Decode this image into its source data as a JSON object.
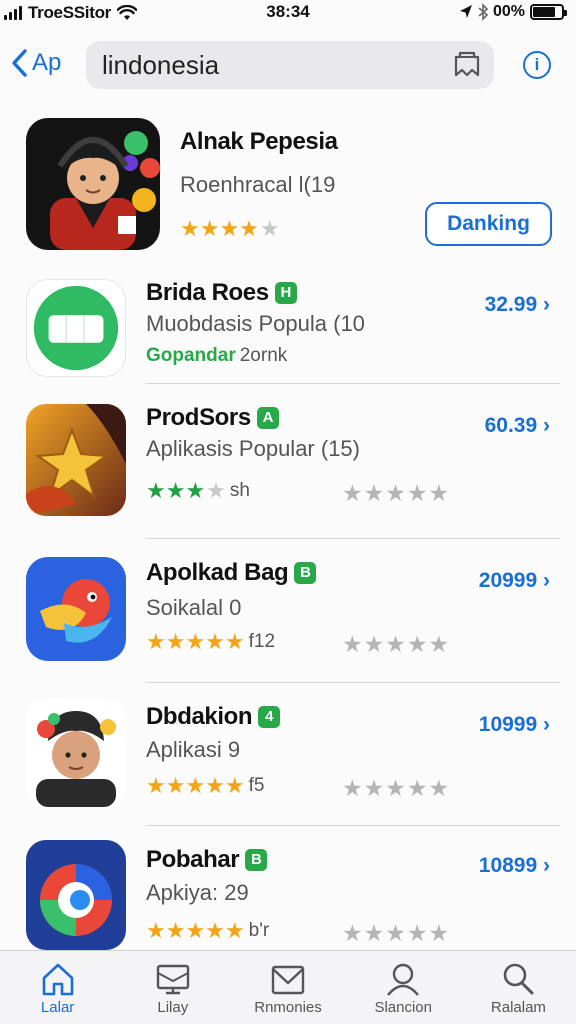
{
  "status_bar": {
    "carrier": "TroeSSitor",
    "time": "38:34",
    "battery": "00%"
  },
  "header": {
    "back_label": "Ap",
    "search_value": "lindonesia",
    "info_label": "i"
  },
  "apps": [
    {
      "name": "Alnak Pepesia",
      "subtitle": "Roenhracal l(19",
      "rating": 4,
      "star_color": "#f2a516",
      "button_label": "Danking"
    },
    {
      "name": "Brida Roes",
      "badge": "H",
      "subtitle": "Muobdasis Popula (10",
      "meta_highlight": "Gopandar",
      "meta_text": "2ornk",
      "price": "32.99"
    },
    {
      "name": "ProdSors",
      "badge": "A",
      "subtitle": "Aplikasis Popular (15)",
      "rating": 3,
      "star_color": "#22a046",
      "meta_text": "sh",
      "price": "60.39"
    },
    {
      "name": "Apolkad Bag",
      "badge": "B",
      "subtitle": "Soikalal 0",
      "rating": 5,
      "star_color": "#f2a516",
      "meta_text": "f12",
      "price": "20999"
    },
    {
      "name": "Dbdakion",
      "badge": "4",
      "subtitle": "Aplikasi 9",
      "rating": 5,
      "star_color": "#f2a516",
      "meta_text": "f5",
      "price": "10999"
    },
    {
      "name": "Pobahar",
      "badge": "B",
      "subtitle": "Apkiya: 29",
      "rating": 5,
      "star_color": "#f2a516",
      "meta_text": "b'r",
      "price": "10899"
    }
  ],
  "tabs": [
    {
      "label": "Lalar",
      "icon": "home-icon",
      "active": true
    },
    {
      "label": "Lilay",
      "icon": "screen-icon"
    },
    {
      "label": "Rnmonies",
      "icon": "mail-icon"
    },
    {
      "label": "Slancion",
      "icon": "person-icon"
    },
    {
      "label": "Ralalam",
      "icon": "search-icon"
    }
  ],
  "colors": {
    "accent": "#1a6fd6",
    "badge_green": "#29a84a",
    "star_gold": "#f2a516"
  }
}
